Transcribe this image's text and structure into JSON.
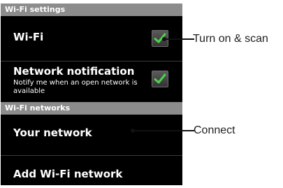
{
  "sections": {
    "wifi_settings": "Wi-Fi settings",
    "wifi_networks": "Wi-Fi networks"
  },
  "rows": {
    "wifi": {
      "title": "Wi-Fi",
      "checked": true
    },
    "notification": {
      "title": "Network notification",
      "subtitle": "Notify me when an open network is available",
      "checked": true
    },
    "your_network": {
      "title": "Your network"
    },
    "add_network": {
      "title": "Add Wi-Fi network"
    }
  },
  "callouts": {
    "turn_on": "Turn on & scan",
    "connect": "Connect"
  },
  "colors": {
    "panel_background": "#000000",
    "section_header": "#8c8c8c",
    "check_mark": "#4cd44c",
    "leader_line": "#111111"
  }
}
